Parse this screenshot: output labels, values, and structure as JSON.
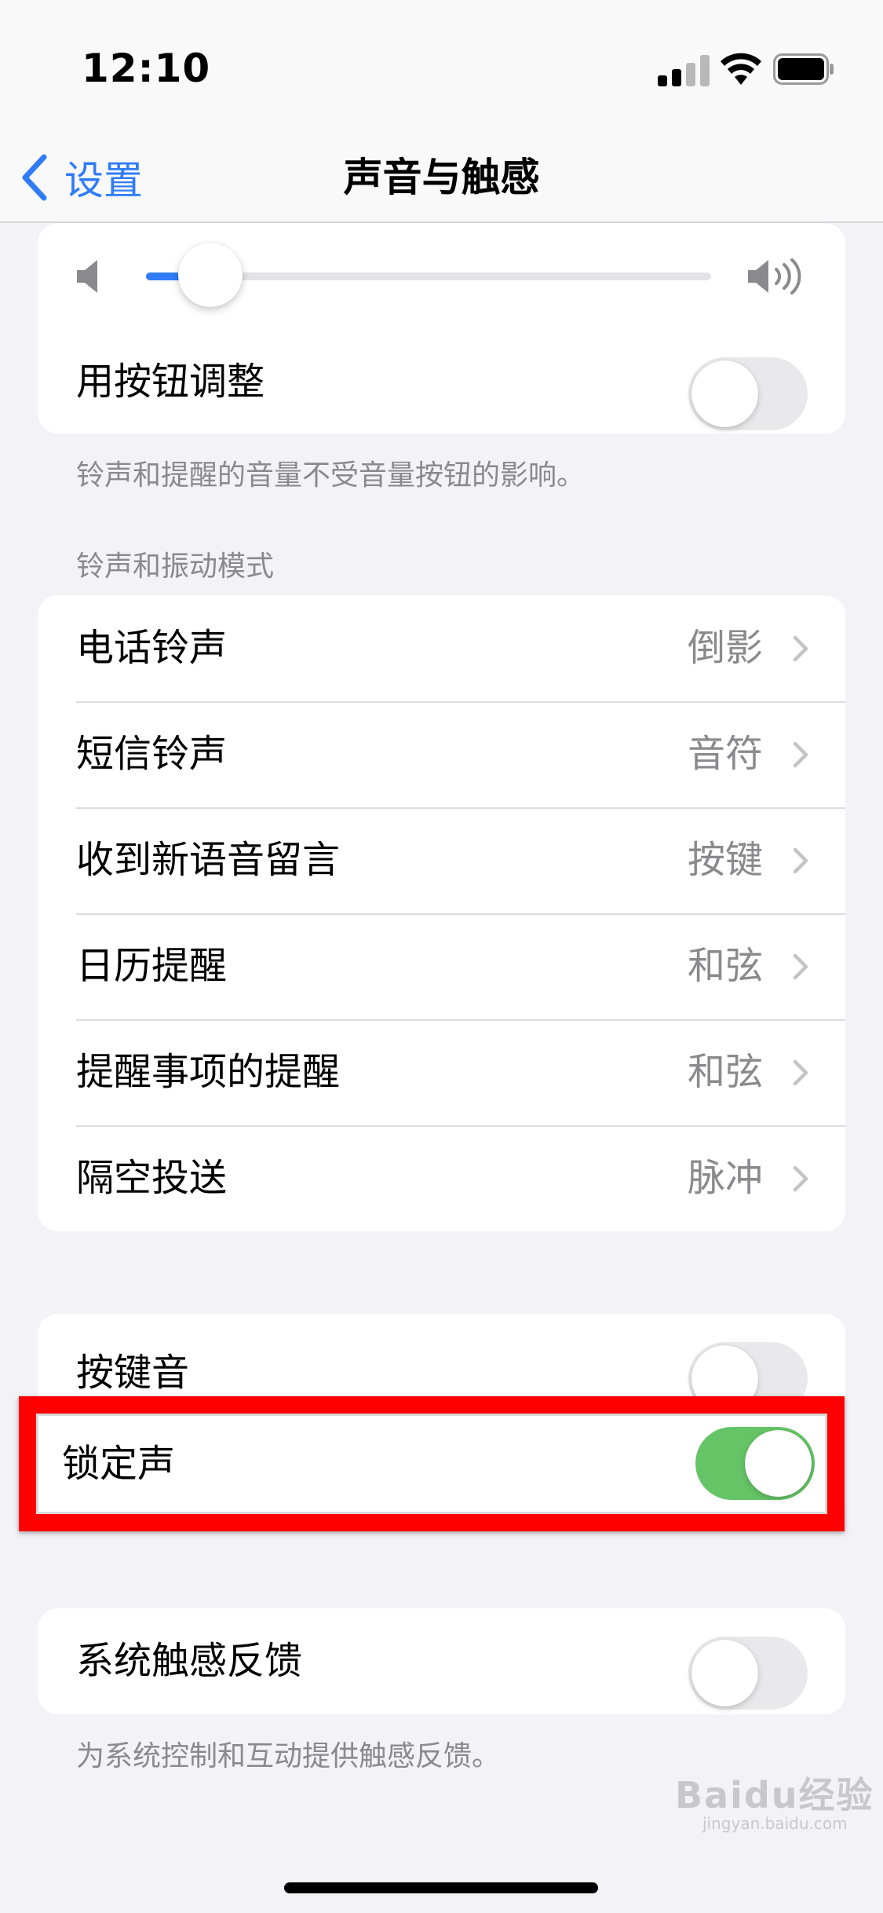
{
  "status_bar": {
    "time": "12:10"
  },
  "nav": {
    "back_label": "设置",
    "title": "声音与触感"
  },
  "volume": {
    "level": 0.065
  },
  "adjust_with_buttons": {
    "label": "用按钮调整",
    "on": false
  },
  "volume_note": "铃声和提醒的音量不受音量按钮的影响。",
  "ringtone_section": {
    "header": "铃声和振动模式",
    "items": [
      {
        "label": "电话铃声",
        "value": "倒影"
      },
      {
        "label": "短信铃声",
        "value": "音符"
      },
      {
        "label": "收到新语音留言",
        "value": "按键"
      },
      {
        "label": "日历提醒",
        "value": "和弦"
      },
      {
        "label": "提醒事项的提醒",
        "value": "和弦"
      },
      {
        "label": "隔空投送",
        "value": "脉冲"
      }
    ]
  },
  "keyboard_clicks": {
    "label": "按键音",
    "on": false
  },
  "lock_sound": {
    "label": "锁定声",
    "on": true
  },
  "system_haptics": {
    "label": "系统触感反馈",
    "on": false
  },
  "haptics_note": "为系统控制和互动提供触感反馈。",
  "watermark": {
    "text": "Baidu经验",
    "sub": "jingyan.baidu.com"
  },
  "colors": {
    "accent": "#2f7cf6",
    "toggle_on": "#65c466",
    "highlight": "#ff0000",
    "background": "#f2f2f7"
  }
}
